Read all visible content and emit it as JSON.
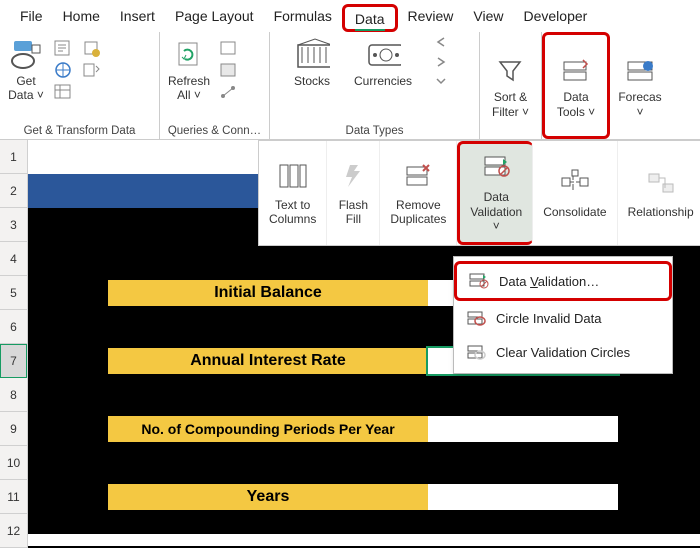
{
  "tabs": {
    "file": "File",
    "home": "Home",
    "insert": "Insert",
    "pageLayout": "Page Layout",
    "formulas": "Formulas",
    "data": "Data",
    "review": "Review",
    "view": "View",
    "developer": "Developer"
  },
  "ribbon": {
    "getData": "Get\nData ˅",
    "getTransform": "Get & Transform Data",
    "refreshAll": "Refresh\nAll ˅",
    "queriesConn": "Queries & Conn…",
    "stocks": "Stocks",
    "currencies": "Currencies",
    "dataTypes": "Data Types",
    "sortFilter": "Sort &\nFilter ˅",
    "dataTools": "Data\nTools ˅",
    "forecast": "Forecas\n˅"
  },
  "sub": {
    "textToColumns": "Text to\nColumns",
    "flashFill": "Flash\nFill",
    "removeDuplicates": "Remove\nDuplicates",
    "dataValidation": "Data\nValidation ˅",
    "consolidate": "Consolidate",
    "relationships": "Relationship"
  },
  "menu": {
    "dataValidation": "Data Validation…",
    "circleInvalid": "Circle Invalid Data",
    "clearCircles": "Clear Validation Circles"
  },
  "labels": {
    "initialBalance": "Initial Balance",
    "annualRate": "Annual Interest Rate",
    "periods": "No. of Compounding Periods Per Year",
    "years": "Years"
  },
  "rows": [
    "1",
    "2",
    "3",
    "4",
    "5",
    "6",
    "7",
    "8",
    "9",
    "10",
    "11",
    "12"
  ]
}
